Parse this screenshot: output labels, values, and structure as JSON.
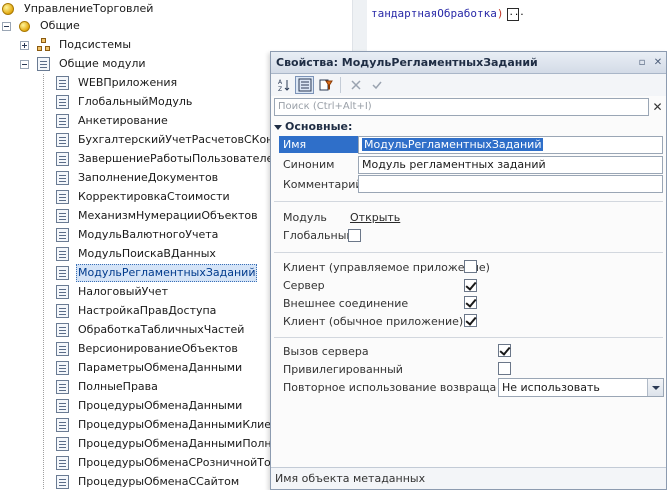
{
  "tree": {
    "root": "УправлениеТорговлей",
    "general": "Общие",
    "subsystems": "Подсистемы",
    "common_modules": "Общие модули",
    "modules": [
      "WEBПриложения",
      "ГлобальныйМодуль",
      "Анкетирование",
      "БухгалтерскийУчетРасчетовСКонтра",
      "ЗавершениеРаботыПользователей",
      "ЗаполнениеДокументов",
      "КорректировкаСтоимости",
      "МеханизмНумерацииОбъектов",
      "МодульВалютногоУчета",
      "МодульПоискаВДанных",
      "МодульРегламентныхЗаданий",
      "НалоговыйУчет",
      "НастройкаПравДоступа",
      "ОбработкаТабличныхЧастей",
      "ВерсионированиеОбъектов",
      "ПараметрыОбменаДанными",
      "ПолныеПрава",
      "ПроцедурыОбменаДанными",
      "ПроцедурыОбменаДаннымиКлиент",
      "ПроцедурыОбменаДаннымиПолныеП",
      "ПроцедурыОбменаСРозничнойТоргов",
      "ПроцедурыОбменаССайтом"
    ],
    "selected_index": 10
  },
  "editor": {
    "code": "тандартнаяОбработка",
    "close_paren": ")",
    "ellipsis": "..."
  },
  "panel": {
    "title": "Свойства: МодульРегламентныхЗаданий",
    "pin_glyph": "▫",
    "close_glyph": "✕",
    "search_placeholder": "Поиск (Ctrl+Alt+I)",
    "search_clear": "✕",
    "section": "Основные:",
    "name_label": "Имя",
    "name_value": "МодульРегламентныхЗаданий",
    "synonym_label": "Синоним",
    "synonym_value": "Модуль регламентных заданий",
    "comment_label": "Комментарий",
    "comment_value": "",
    "module_label": "Модуль",
    "module_link": "Открыть",
    "global_label": "Глобальный",
    "global_checked": false,
    "client_managed_label": "Клиент (управляемое приложение)",
    "client_managed_checked": false,
    "server_label": "Сервер",
    "server_checked": true,
    "external_label": "Внешнее соединение",
    "external_checked": true,
    "client_ordinary_label": "Клиент (обычное приложение)",
    "client_ordinary_checked": true,
    "server_call_label": "Вызов сервера",
    "server_call_checked": true,
    "privileged_label": "Привилегированный",
    "privileged_checked": false,
    "reuse_label": "Повторное использование возвращаемых",
    "reuse_value": "Не использовать",
    "status": "Имя объекта метаданных"
  }
}
